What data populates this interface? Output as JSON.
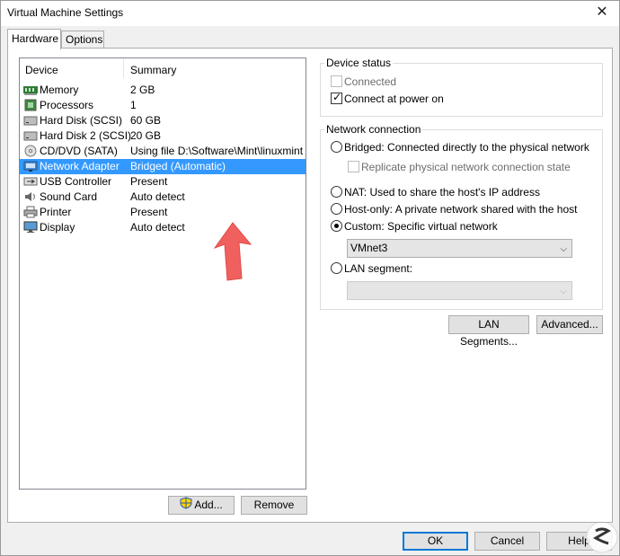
{
  "window": {
    "title": "Virtual Machine Settings"
  },
  "tabs": [
    {
      "label": "Hardware",
      "active": true
    },
    {
      "label": "Options",
      "active": false
    }
  ],
  "device_list": {
    "columns": [
      "Device",
      "Summary"
    ],
    "rows": [
      {
        "icon": "memory-icon",
        "name": "Memory",
        "summary": "2 GB"
      },
      {
        "icon": "processor-icon",
        "name": "Processors",
        "summary": "1"
      },
      {
        "icon": "hard-disk-icon",
        "name": "Hard Disk (SCSI)",
        "summary": "60 GB"
      },
      {
        "icon": "hard-disk-icon",
        "name": "Hard Disk 2 (SCSI)",
        "summary": "20 GB"
      },
      {
        "icon": "cd-dvd-icon",
        "name": "CD/DVD (SATA)",
        "summary": "Using file D:\\Software\\Mint\\linuxmint..."
      },
      {
        "icon": "network-adapter-icon",
        "name": "Network Adapter",
        "summary": "Bridged (Automatic)",
        "selected": true
      },
      {
        "icon": "usb-icon",
        "name": "USB Controller",
        "summary": "Present"
      },
      {
        "icon": "sound-card-icon",
        "name": "Sound Card",
        "summary": "Auto detect"
      },
      {
        "icon": "printer-icon",
        "name": "Printer",
        "summary": "Present"
      },
      {
        "icon": "display-icon",
        "name": "Display",
        "summary": "Auto detect"
      }
    ],
    "add_label": "Add...",
    "remove_label": "Remove"
  },
  "device_status": {
    "title": "Device status",
    "connected": {
      "label": "Connected",
      "checked": false,
      "disabled": true
    },
    "connect_at_power_on": {
      "label": "Connect at power on",
      "checked": true
    }
  },
  "network_connection": {
    "title": "Network connection",
    "bridged": "Bridged: Connected directly to the physical network",
    "replicate": "Replicate physical network connection state",
    "nat": "NAT: Used to share the host's IP address",
    "host_only": "Host-only: A private network shared with the host",
    "custom": "Custom: Specific virtual network",
    "custom_value": "VMnet3",
    "lan_segment": "LAN segment:",
    "lan_segment_value": "",
    "selected": "custom"
  },
  "buttons": {
    "lan_segments": "LAN Segments...",
    "advanced": "Advanced...",
    "ok": "OK",
    "cancel": "Cancel",
    "help": "Help"
  },
  "colors": {
    "selection": "#3399ff",
    "annotation_arrow": "#f0605e"
  }
}
